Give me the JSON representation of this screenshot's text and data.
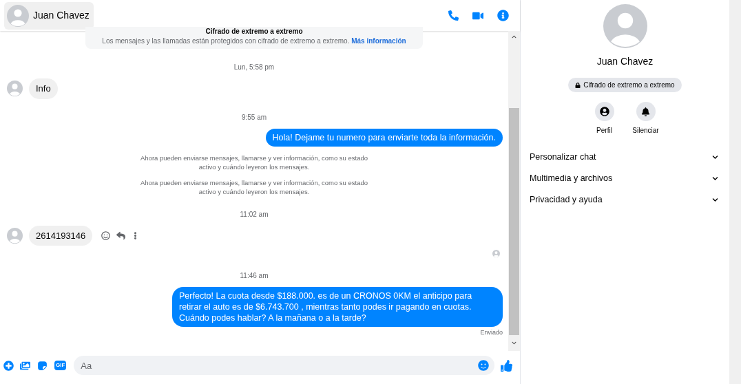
{
  "header": {
    "name": "Juan Chavez"
  },
  "messages": [
    {
      "kind": "notice",
      "title": "Cifrado de extremo a extremo",
      "text": "Los mensajes y las llamadas están protegidos con cifrado de extremo a extremo.",
      "link": "Más información"
    },
    {
      "kind": "time",
      "text": "Lun, 5:58 pm"
    },
    {
      "kind": "incoming",
      "text": "Info"
    },
    {
      "kind": "time",
      "text": "9:55 am"
    },
    {
      "kind": "outgoing",
      "text": "Hola! Dejame tu numero  para enviarte toda la información."
    },
    {
      "kind": "system",
      "text": "Ahora pueden enviarse mensajes, llamarse y ver información, como su estado activo y cuándo leyeron los mensajes."
    },
    {
      "kind": "system",
      "text": "Ahora pueden enviarse mensajes, llamarse y ver información, como su estado activo y cuándo leyeron los mensajes."
    },
    {
      "kind": "time",
      "text": "11:02 am"
    },
    {
      "kind": "incoming",
      "text": "2614193146",
      "actions": true
    },
    {
      "kind": "seen"
    },
    {
      "kind": "time",
      "text": "11:46 am"
    },
    {
      "kind": "outgoing",
      "text": "Perfecto! La cuota desde $188.000. es de un CRONOS 0KM el anticipo para retirar el auto es de $6.743.700 , mientras tanto podes ir pagando en cuotas. Cuándo podes hablar? A la mañana o a la tarde?"
    },
    {
      "kind": "status",
      "text": "Enviado"
    }
  ],
  "composer": {
    "gif_label": "GIF",
    "placeholder": "Aa"
  },
  "profile": {
    "name": "Juan Chavez",
    "badge": "Cifrado de extremo a extremo",
    "actions": [
      {
        "kind": "profile",
        "label": "Perfil"
      },
      {
        "kind": "mute",
        "label": "Silenciar"
      }
    ],
    "sections": [
      {
        "label": "Personalizar chat",
        "expanded": false
      },
      {
        "label": "Multimedia y archivos",
        "expanded": false
      },
      {
        "label": "Privacidad y ayuda",
        "expanded": false
      }
    ]
  }
}
